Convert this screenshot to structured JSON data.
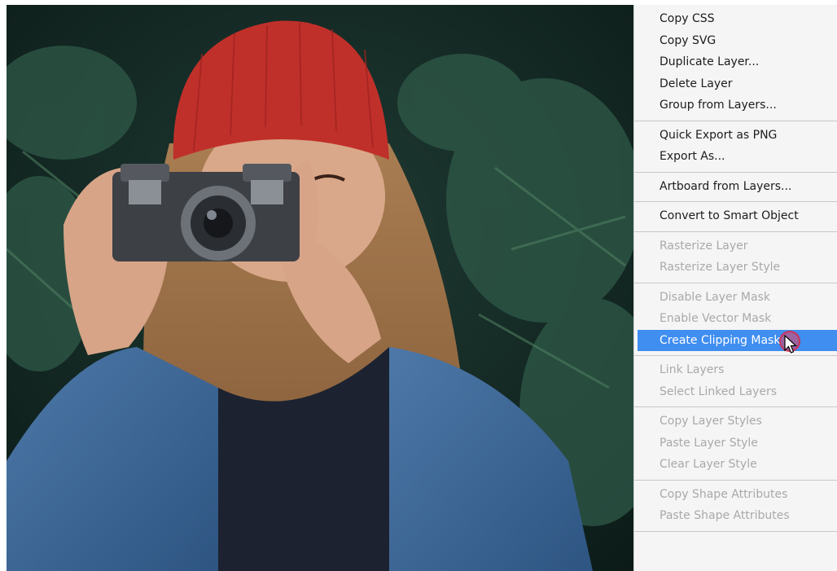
{
  "photo": {
    "subject": "woman-taking-photo-with-camera-icon"
  },
  "context_menu": {
    "groups": [
      {
        "items": [
          {
            "label": "Copy CSS",
            "enabled": true
          },
          {
            "label": "Copy SVG",
            "enabled": true
          },
          {
            "label": "Duplicate Layer...",
            "enabled": true
          },
          {
            "label": "Delete Layer",
            "enabled": true
          },
          {
            "label": "Group from Layers...",
            "enabled": true
          }
        ]
      },
      {
        "items": [
          {
            "label": "Quick Export as PNG",
            "enabled": true
          },
          {
            "label": "Export As...",
            "enabled": true
          }
        ]
      },
      {
        "items": [
          {
            "label": "Artboard from Layers...",
            "enabled": true
          }
        ]
      },
      {
        "items": [
          {
            "label": "Convert to Smart Object",
            "enabled": true
          }
        ]
      },
      {
        "items": [
          {
            "label": "Rasterize Layer",
            "enabled": false
          },
          {
            "label": "Rasterize Layer Style",
            "enabled": false
          }
        ]
      },
      {
        "items": [
          {
            "label": "Disable Layer Mask",
            "enabled": false
          },
          {
            "label": "Enable Vector Mask",
            "enabled": false
          },
          {
            "label": "Create Clipping Mask",
            "enabled": true,
            "highlighted": true
          }
        ]
      },
      {
        "items": [
          {
            "label": "Link Layers",
            "enabled": false
          },
          {
            "label": "Select Linked Layers",
            "enabled": false
          }
        ]
      },
      {
        "items": [
          {
            "label": "Copy Layer Styles",
            "enabled": false
          },
          {
            "label": "Paste Layer Style",
            "enabled": false
          },
          {
            "label": "Clear Layer Style",
            "enabled": false
          }
        ]
      },
      {
        "items": [
          {
            "label": "Copy Shape Attributes",
            "enabled": false
          },
          {
            "label": "Paste Shape Attributes",
            "enabled": false
          }
        ]
      },
      {
        "items": [
          {
            "label": "",
            "enabled": false,
            "cut_off": true
          }
        ]
      }
    ],
    "highlight_color": "#3f8ef0",
    "cursor": "arrow-cursor-icon",
    "click_indicator_color": "#e73f5c"
  }
}
